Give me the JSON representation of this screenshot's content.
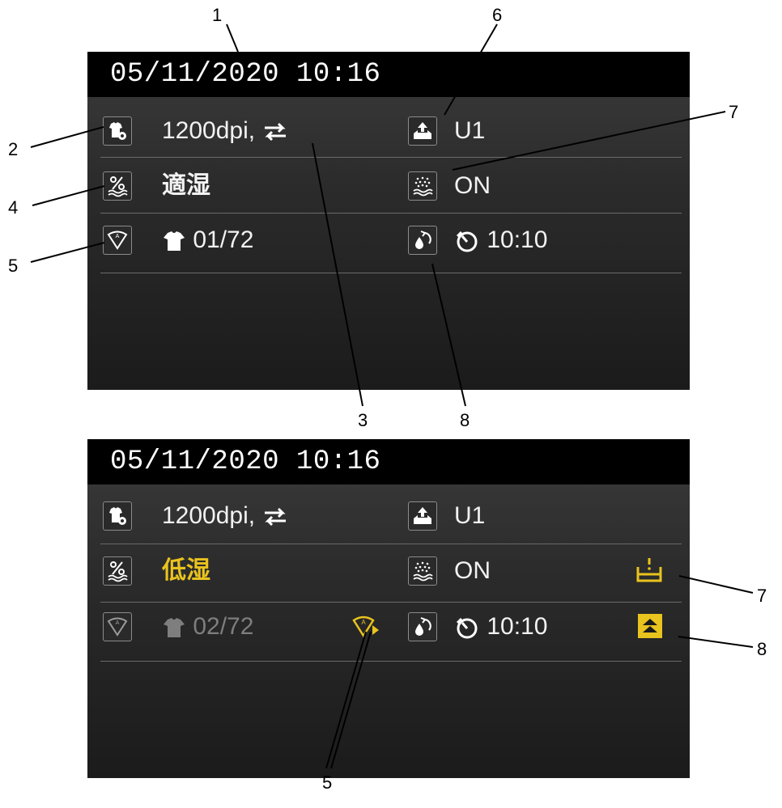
{
  "top_screen": {
    "datetime": "05/11/2020 10:16",
    "resolution": "1200dpi,",
    "humidity_status": "適湿",
    "job_count": "01/72",
    "unit": "U1",
    "humidifier": "ON",
    "timer": "10:10"
  },
  "bottom_screen": {
    "datetime": "05/11/2020 10:16",
    "resolution": "1200dpi,",
    "humidity_status": "低湿",
    "job_count": "02/72",
    "unit": "U1",
    "humidifier": "ON",
    "timer": "10:10"
  },
  "callouts": {
    "top": [
      "1",
      "2",
      "3",
      "4",
      "5",
      "6",
      "7",
      "8"
    ],
    "bottom": [
      "7",
      "8",
      "5"
    ]
  },
  "colors": {
    "warning_yellow": "#e9c31e",
    "text_white": "#f2f2f2",
    "text_dim": "#7e7e7e",
    "datebar": "#000000"
  },
  "icons": {
    "print_settings": "tshirt-gear-icon",
    "direction": "bidirectional-arrows-icon",
    "humidity": "percent-humidity-icon",
    "auto_clean": "auto-wiper-icon",
    "tshirt": "tshirt-icon",
    "unit": "tray-eject-icon",
    "humidifier": "mist-icon",
    "refill": "ink-drop-cycle-icon",
    "timer": "timer-icon",
    "tank_warning": "tank-warning-icon",
    "maintenance_alert": "double-up-chevron-icon",
    "auto_clean_alert": "auto-wiper-alert-icon"
  }
}
